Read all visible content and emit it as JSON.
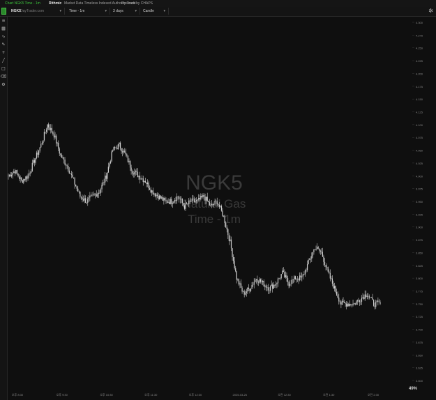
{
  "titlebar": {
    "chart_title": "Chart NGK5 Time - 1m",
    "brand": "Rithmic",
    "brand_tag": "Market Data Timeless Indexed Authority Trade",
    "powered_by": "Powered by CHAPS"
  },
  "toolbar": {
    "symbol": "NGK5",
    "symbol_hint": "DayTrader.com",
    "timeframe": "Time - 1m",
    "range": "3 days",
    "style": "Candle"
  },
  "watermark": {
    "symbol": "NGK5",
    "name": "Natural Gas",
    "timeframe": "Time - 1m"
  },
  "footer": {
    "percent": "49%"
  },
  "colors": {
    "background": "#0f0f0f",
    "candle": "#d0d0d0",
    "accent": "#3cc13c",
    "watermark": "#3a3a3a"
  },
  "leftbar_icons": [
    "layers-icon",
    "chart-type-icon",
    "indicator-icon",
    "pencil-icon",
    "crosshair-icon",
    "line-tool-icon",
    "rect-tool-icon",
    "eraser-icon",
    "settings-icon"
  ],
  "chart_data": {
    "type": "candlestick",
    "price_label": "",
    "ylim": [
      3.6,
      4.3
    ],
    "y_ticks": [
      "4.300",
      "4.275",
      "4.250",
      "4.225",
      "4.200",
      "4.175",
      "4.150",
      "4.125",
      "4.100",
      "4.075",
      "4.050",
      "4.025",
      "4.000",
      "3.975",
      "3.950",
      "3.925",
      "3.900",
      "3.875",
      "3.850",
      "3.825",
      "3.800",
      "3.775",
      "3.750",
      "3.725",
      "3.700",
      "3.675",
      "3.650",
      "3.625",
      "3.600"
    ],
    "x_ticks": [
      "오후 8:30",
      "오후 9:30",
      "오후 10:30",
      "오후 11:30",
      "오후 12:30",
      "2025-03-26",
      "오전 12:30",
      "오전 1:30",
      "오전 2:30"
    ],
    "series": [
      {
        "values": [
          4.0,
          4.01,
          3.99,
          4.0,
          4.03,
          4.06,
          4.1,
          4.08,
          4.04,
          4.02,
          3.99,
          3.96,
          3.95,
          3.96,
          3.97,
          4.0,
          4.05,
          4.06,
          4.04,
          4.01,
          4.0,
          3.99,
          3.97,
          3.96,
          3.95,
          3.95,
          3.96,
          3.94,
          3.95,
          3.95,
          3.96,
          3.94,
          3.95,
          3.92,
          3.87,
          3.8,
          3.77,
          3.78,
          3.8,
          3.79,
          3.78,
          3.79,
          3.81,
          3.79,
          3.8,
          3.8,
          3.83,
          3.86,
          3.85,
          3.81,
          3.78,
          3.75,
          3.75,
          3.75,
          3.76,
          3.77,
          3.75,
          3.75
        ]
      }
    ]
  }
}
